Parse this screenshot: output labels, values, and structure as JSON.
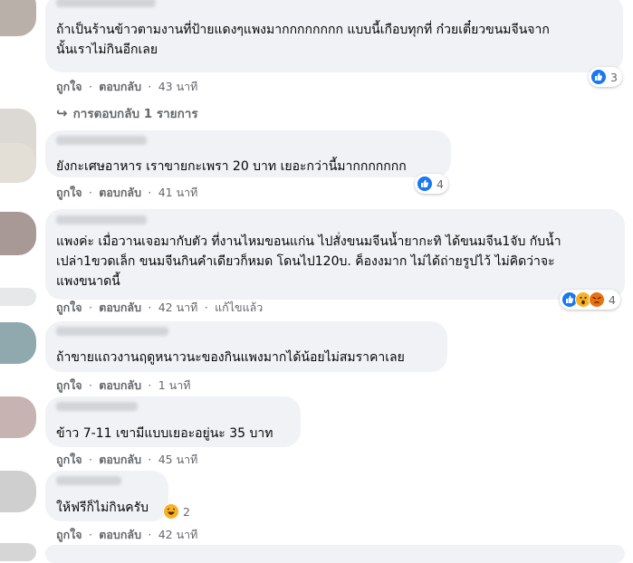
{
  "comments": [
    {
      "lines": [
        "ถ้าเป็นร้านข้าวตามงานที่ป้ายแดงๆแพงมากกกกกกกก แบบนี้เกือบทุกที่ ก๋วยเตี๋ยวขนมจีนจาก",
        "นั้นเราไม่กินอีกเลย"
      ],
      "like": "ถูกใจ",
      "reply": "ตอบกลับ",
      "time": "43 นาที",
      "edited": "",
      "reactions": [
        "like"
      ],
      "reaction_count": "3",
      "replies_link": "การตอบกลับ 1 รายการ"
    },
    {
      "lines": [
        "ยังกะเศษอาหาร เราขายกะเพรา 20 บาท เยอะกว่านี้มากกกกกกก"
      ],
      "like": "ถูกใจ",
      "reply": "ตอบกลับ",
      "time": "41 นาที",
      "edited": "",
      "reactions": [
        "like"
      ],
      "reaction_count": "4"
    },
    {
      "lines": [
        "แพงค่ะ เมื่อวานเจอมากับตัว ที่งานไหมขอนแก่น ไปสั่งขนมจีนน้ำยากะทิ ได้ขนมจีน1จับ กับน้ำ",
        "เปล่า1ขวดเล็ก ขนมจีนกินคำเดียวก็หมด โดนไป120บ. ค็องงมาก ไม่ได้ถ่ายรูปไว้ ไม่คิดว่าจะ",
        "แพงขนาดนี้"
      ],
      "like": "ถูกใจ",
      "reply": "ตอบกลับ",
      "time": "42 นาที",
      "edited": "แก้ไขแล้ว",
      "reactions": [
        "like",
        "wow",
        "angry"
      ],
      "reaction_count": "4"
    },
    {
      "lines": [
        "ถ้าขายแถวงานฤดูหนาวนะของกินแพงมากได้น้อยไม่สมราคาเลย"
      ],
      "like": "ถูกใจ",
      "reply": "ตอบกลับ",
      "time": "1 นาที",
      "edited": "",
      "reactions": [],
      "reaction_count": ""
    },
    {
      "lines": [
        "ข้าว 7-11 เขามีแบบเยอะอยู่นะ 35 บาท"
      ],
      "like": "ถูกใจ",
      "reply": "ตอบกลับ",
      "time": "45 นาที",
      "edited": "",
      "reactions": [],
      "reaction_count": ""
    },
    {
      "lines": [
        "ให้ฟรีก็ไม่กินครับ"
      ],
      "like": "ถูกใจ",
      "reply": "ตอบกลับ",
      "time": "42 นาที",
      "edited": "",
      "reactions": [
        "haha"
      ],
      "reaction_count": "2"
    }
  ],
  "sep": "·",
  "colors": {
    "like": "#1877f2",
    "haha": "#f7b125",
    "angry": "#e9710f",
    "bubble": "#f0f2f5",
    "meta": "#65676b"
  },
  "icons": {
    "like": "thumbs-up-icon",
    "wow": "wow-icon",
    "angry": "angry-icon",
    "haha": "laugh-icon",
    "reply_arrow": "reply-arrow-icon"
  }
}
